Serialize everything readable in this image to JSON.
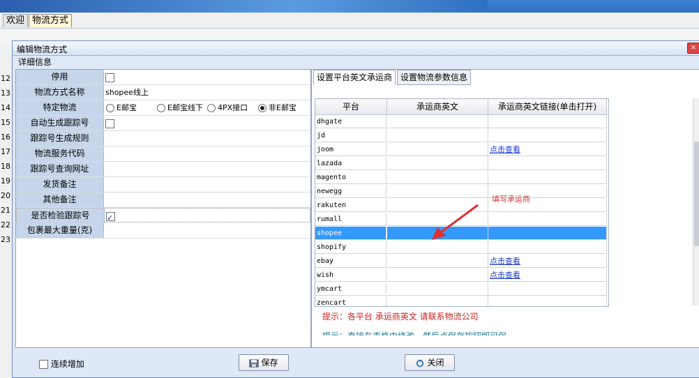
{
  "top_tabs": [
    "欢迎",
    "物流方式"
  ],
  "dialog": {
    "title": "编辑物流方式",
    "section_label": "详细信息",
    "close_symbol": "×"
  },
  "row_numbers": [
    "12",
    "13",
    "14",
    "15",
    "16",
    "17",
    "18",
    "19",
    "20",
    "21",
    "22",
    "23"
  ],
  "form": {
    "disabled_label": "停用",
    "name_label": "物流方式名称",
    "name_value": "shopee线上",
    "special_label": "特定物流",
    "special_options": [
      "E邮宝",
      "E邮宝线下",
      "4PX接口",
      "非E邮宝"
    ],
    "special_selected": "非E邮宝",
    "auto_gen_label": "自动生成跟踪号",
    "rule_label": "跟踪号生成规则",
    "service_code_label": "物流服务代码",
    "query_url_label": "跟踪号查询网址",
    "ship_note_label": "发货备注",
    "other_note_label": "其他备注",
    "check_track_label": "是否检验跟踪号",
    "check_track_value": true,
    "max_weight_label": "包裹最大重量(克)"
  },
  "right_tabs": [
    "设置平台英文承运商",
    "设置物流参数信息"
  ],
  "grid": {
    "headers": [
      "平台",
      "承运商英文",
      "承运商英文链接(单击打开)"
    ],
    "rows": [
      {
        "platform": "dhgate",
        "carrier": "",
        "link": ""
      },
      {
        "platform": "jd",
        "carrier": "",
        "link": ""
      },
      {
        "platform": "joom",
        "carrier": "",
        "link": "点击查看"
      },
      {
        "platform": "lazada",
        "carrier": "",
        "link": ""
      },
      {
        "platform": "magento",
        "carrier": "",
        "link": ""
      },
      {
        "platform": "newegg",
        "carrier": "",
        "link": ""
      },
      {
        "platform": "rakuten",
        "carrier": "",
        "link": ""
      },
      {
        "platform": "rumall",
        "carrier": "",
        "link": ""
      },
      {
        "platform": "shopee",
        "carrier": "",
        "link": ""
      },
      {
        "platform": "shopify",
        "carrier": "",
        "link": ""
      },
      {
        "platform": "ebay",
        "carrier": "",
        "link": "点击查看"
      },
      {
        "platform": "wish",
        "carrier": "",
        "link": "点击查看"
      },
      {
        "platform": "ymcart",
        "carrier": "",
        "link": ""
      },
      {
        "platform": "zencart",
        "carrier": "",
        "link": ""
      }
    ],
    "selected_platform": "shopee"
  },
  "annotation": "填写承运商",
  "hint1": "提示：各平台 承运商英文 请联系物流公司",
  "hint2": "提示：直接在表格中修改，然后点保存按钮即可保",
  "bottom": {
    "continuous_add_label": "连续增加",
    "save_label": "保存",
    "close_label": "关闭"
  },
  "colors": {
    "selected_row": "#3399ff",
    "link": "#1a3cc9",
    "annotation": "#d03a3a"
  }
}
